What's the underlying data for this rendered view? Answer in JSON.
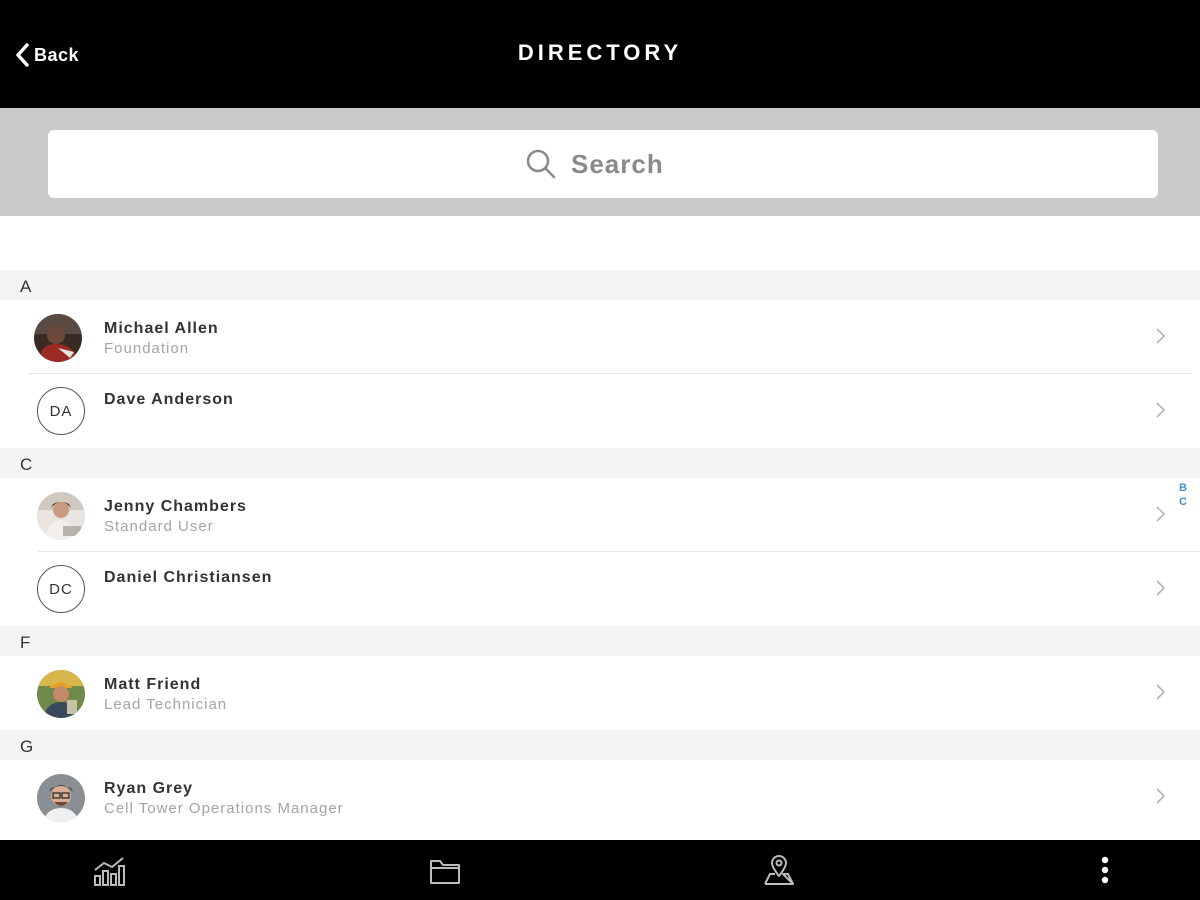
{
  "header": {
    "back_label": "Back",
    "title": "DIRECTORY"
  },
  "search": {
    "placeholder": "Search"
  },
  "sections": [
    {
      "letter": "A",
      "contacts": [
        {
          "name": "Michael Allen",
          "subtitle": "Foundation",
          "avatar": "photo-man-red-shirt"
        },
        {
          "name": "Dave Anderson",
          "subtitle": "",
          "initials": "DA"
        }
      ]
    },
    {
      "letter": "C",
      "contacts": [
        {
          "name": "Jenny Chambers",
          "subtitle": "Standard User",
          "avatar": "photo-woman-at-desk"
        },
        {
          "name": "Daniel Christiansen",
          "subtitle": "",
          "initials": "DC"
        }
      ]
    },
    {
      "letter": "F",
      "contacts": [
        {
          "name": "Matt Friend",
          "subtitle": "Lead Technician",
          "avatar": "photo-worker-hardhat"
        }
      ]
    },
    {
      "letter": "G",
      "contacts": [
        {
          "name": "Ryan Grey",
          "subtitle": "Cell Tower Operations Manager",
          "avatar": "photo-man-glasses"
        }
      ]
    }
  ],
  "index_bar": [
    "B",
    "C"
  ],
  "tabbar": {
    "icons": [
      "analytics-icon",
      "folder-icon",
      "map-pin-icon",
      "more-vertical-icon"
    ]
  },
  "colors": {
    "header_bg": "#000000",
    "search_band_bg": "#c9c9cc",
    "section_header_bg": "#f4f4f6",
    "index_accent": "#4a90c8"
  }
}
